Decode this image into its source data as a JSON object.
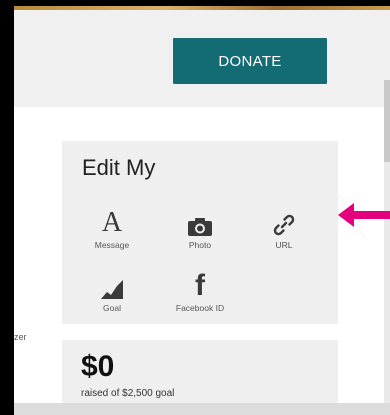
{
  "header": {
    "donate_label": "DONATE"
  },
  "edit_card": {
    "title": "Edit My",
    "items": [
      {
        "label": "Message",
        "icon": "letter-a-icon"
      },
      {
        "label": "Photo",
        "icon": "camera-icon"
      },
      {
        "label": "URL",
        "icon": "link-icon"
      },
      {
        "label": "Goal",
        "icon": "goal-chart-icon"
      },
      {
        "label": "Facebook ID",
        "icon": "facebook-icon"
      }
    ]
  },
  "side_text": "zer",
  "goal_card": {
    "amount": "$0",
    "raised_text": "raised of $2,500 goal"
  },
  "colors": {
    "accent": "#136b73",
    "arrow": "#e4007c",
    "card_bg": "#efefef",
    "header_bg": "#f0f0f0"
  }
}
